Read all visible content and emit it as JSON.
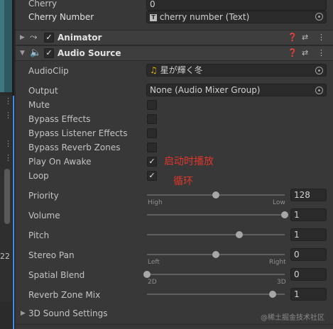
{
  "fields": {
    "cherry_label": "Cherry",
    "cherry_value": "0",
    "cherry_number_label": "Cherry Number",
    "cherry_number_value": "cherry number (Text)",
    "cherry_number_type_icon": "text-icon"
  },
  "animator": {
    "title": "Animator",
    "enabled": true
  },
  "audio_source": {
    "title": "Audio Source",
    "enabled": true,
    "audioclip_label": "AudioClip",
    "audioclip_value": "星が輝く冬",
    "output_label": "Output",
    "output_value": "None (Audio Mixer Group)",
    "mute_label": "Mute",
    "mute": false,
    "bypass_effects_label": "Bypass Effects",
    "bypass_effects": false,
    "bypass_listener_label": "Bypass Listener Effects",
    "bypass_listener": false,
    "bypass_reverb_label": "Bypass Reverb Zones",
    "bypass_reverb": false,
    "play_on_awake_label": "Play On Awake",
    "play_on_awake": true,
    "loop_label": "Loop",
    "loop": true,
    "priority": {
      "label": "Priority",
      "value": "128",
      "min_label": "High",
      "max_label": "Low",
      "level": 0.5
    },
    "volume": {
      "label": "Volume",
      "value": "1",
      "level": 1.0
    },
    "pitch": {
      "label": "Pitch",
      "value": "1",
      "level": 0.67
    },
    "stereo_pan": {
      "label": "Stereo Pan",
      "value": "0",
      "min_label": "Left",
      "max_label": "Right",
      "level": 0.5
    },
    "spatial_blend": {
      "label": "Spatial Blend",
      "value": "0",
      "min_label": "2D",
      "max_label": "3D",
      "level": 0.0
    },
    "reverb_zone_mix": {
      "label": "Reverb Zone Mix",
      "value": "1",
      "level": 0.91
    },
    "sound3d_label": "3D Sound Settings"
  },
  "annotations": {
    "play_on_awake_note": "启动时播放",
    "loop_note": "循环"
  },
  "left_panel": {
    "number": "22"
  },
  "watermark": "@稀土掘金技术社区",
  "colors": {
    "annotation_red": "#e0362c",
    "panel_bg": "#383838",
    "field_bg": "#2a2a2a"
  }
}
